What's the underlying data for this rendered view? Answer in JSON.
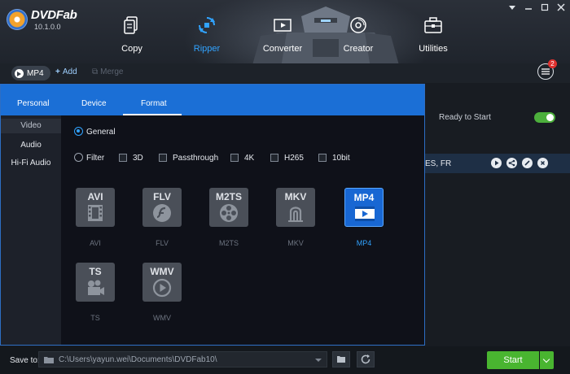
{
  "app": {
    "name": "DVDFab",
    "version": "10.1.0.0"
  },
  "nav": [
    {
      "label": "Copy",
      "icon": "copy-icon"
    },
    {
      "label": "Ripper",
      "icon": "ripper-icon",
      "active": true
    },
    {
      "label": "Converter",
      "icon": "converter-icon"
    },
    {
      "label": "Creator",
      "icon": "creator-icon"
    },
    {
      "label": "Utilities",
      "icon": "utilities-icon"
    }
  ],
  "toolbar": {
    "format_label": "MP4",
    "add_label": "Add",
    "merge_label": "Merge",
    "queue_badge": "2"
  },
  "main": {
    "ready_label": "Ready to Start",
    "ready_enabled": true,
    "languages": "ES, FR"
  },
  "panel": {
    "tabs": [
      "Personal",
      "Device",
      "Format"
    ],
    "active_tab": "Format",
    "sidebar": [
      "Video",
      "Audio",
      "Hi-Fi Audio"
    ],
    "active_side": "Video",
    "general_label": "General",
    "filter_label": "Filter",
    "filters": [
      "3D",
      "Passthrough",
      "4K",
      "H265",
      "10bit"
    ],
    "formats": [
      {
        "title": "AVI",
        "caption": "AVI",
        "icon": "film-icon"
      },
      {
        "title": "FLV",
        "caption": "FLV",
        "icon": "flash-icon"
      },
      {
        "title": "M2TS",
        "caption": "M2TS",
        "icon": "reel-icon"
      },
      {
        "title": "MKV",
        "caption": "MKV",
        "icon": "matroska-icon"
      },
      {
        "title": "MP4",
        "caption": "MP4",
        "icon": "video-play-icon",
        "selected": true
      },
      {
        "title": "TS",
        "caption": "TS",
        "icon": "camera-icon"
      },
      {
        "title": "WMV",
        "caption": "WMV",
        "icon": "play-circle-icon"
      }
    ]
  },
  "bottom": {
    "save_to_label": "Save to:",
    "path": "C:\\Users\\yayun.wei\\Documents\\DVDFab10\\",
    "start_label": "Start"
  },
  "colors": {
    "accent": "#1b6fd6",
    "start": "#49b530",
    "selected_text": "#31a3ff"
  }
}
